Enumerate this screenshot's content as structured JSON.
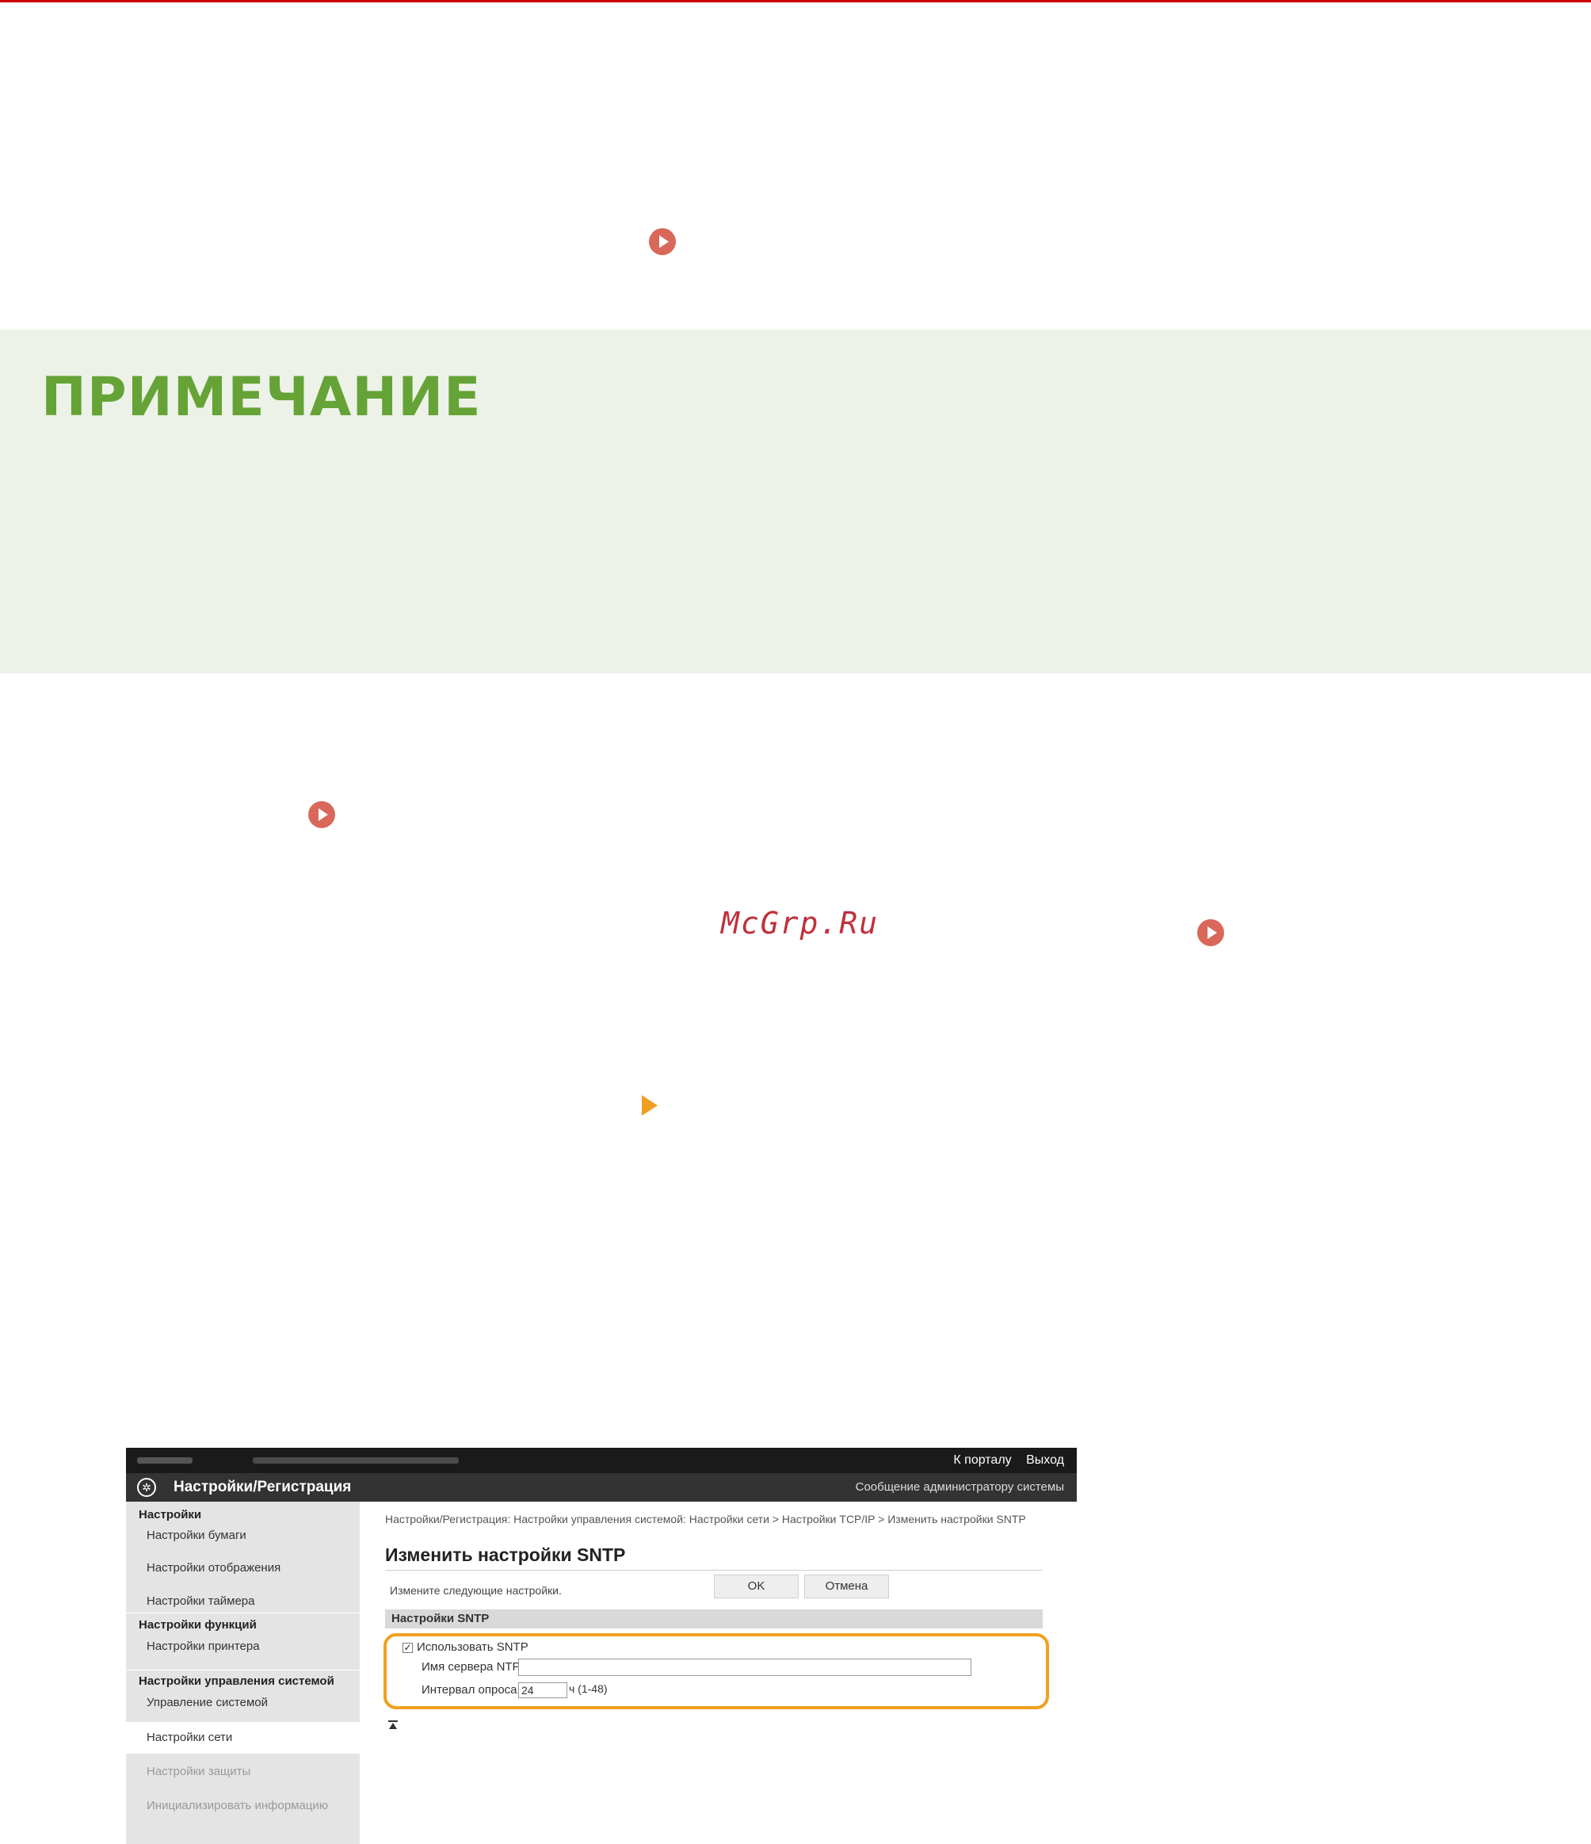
{
  "note": {
    "title": "ПРИМЕЧАНИЕ"
  },
  "watermark": "McGrp.Ru",
  "screenshot": {
    "topbar": {
      "portal_link": "К порталу",
      "logout_link": "Выход"
    },
    "header": {
      "title": "Настройки/Регистрация",
      "admin_message": "Сообщение администратору системы"
    },
    "sidebar": [
      {
        "label": "Настройки",
        "type": "head"
      },
      {
        "label": "Настройки бумаги",
        "type": "item"
      },
      {
        "label": "Настройки отображения",
        "type": "item"
      },
      {
        "label": "Настройки таймера",
        "type": "item"
      },
      {
        "label": "Настройки функций",
        "type": "head"
      },
      {
        "label": "Настройки принтера",
        "type": "item"
      },
      {
        "label": "Настройки управления системой",
        "type": "head"
      },
      {
        "label": "Управление системой",
        "type": "item"
      },
      {
        "label": "Настройки сети",
        "type": "item",
        "active": true
      },
      {
        "label": "Настройки защиты",
        "type": "item"
      },
      {
        "label": "Инициализировать информацию",
        "type": "item"
      }
    ],
    "breadcrumb": "Настройки/Регистрация: Настройки управления системой: Настройки сети > Настройки TCP/IP > Изменить настройки SNTP",
    "page_title": "Изменить настройки SNTP",
    "hint": "Измените следующие настройки.",
    "ok_label": "OK",
    "cancel_label": "Отмена",
    "section_title": "Настройки SNTP",
    "use_sntp_label": "Использовать SNTP",
    "use_sntp_checked": true,
    "ntp_server_label": "Имя сервера NTP:",
    "ntp_server_value": "",
    "poll_interval_label": "Интервал опроса:",
    "poll_interval_value": "24",
    "poll_interval_unit": "ч (1-48)"
  }
}
